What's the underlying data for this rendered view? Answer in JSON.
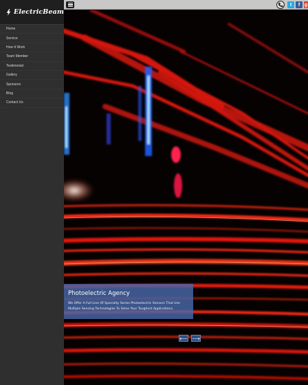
{
  "brand": {
    "name": "ElectricBeam"
  },
  "nav": {
    "items": [
      "Home",
      "Service",
      "How It Work",
      "Team Member",
      "Testimonial",
      "Gallery",
      "Sponsors",
      "Blog",
      "Contact Us"
    ]
  },
  "topbar": {
    "menu_icon": "hamburger-icon",
    "icons": [
      "phone-icon",
      "twitter-icon",
      "facebook-icon",
      "google-plus-icon"
    ],
    "twitter_glyph": "t",
    "facebook_glyph": "f",
    "google_glyph": "g"
  },
  "slider": {
    "caption_title": "Photoelectric Agency",
    "caption_text": "We Offer A Full Line Of Specialty Series Photoelectric Sensors That Use Multiple Sensing Technologies To Solve Your Toughest Applications.",
    "prev_label": "⟵",
    "next_label": "⟶"
  },
  "colors": {
    "sidebar": "#2f2f2f",
    "caption_bg": "#4868aa",
    "accent_red": "#e0201a"
  }
}
